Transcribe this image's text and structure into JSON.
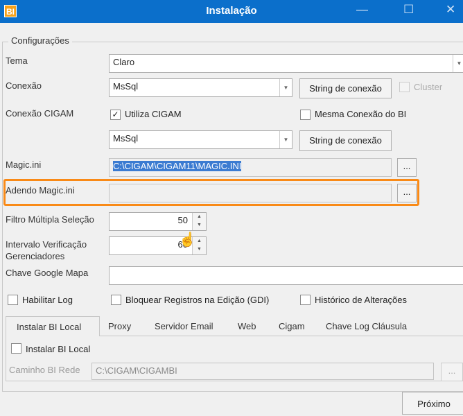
{
  "window": {
    "title": "Instalação",
    "logo": "BI",
    "controls": [
      "minimize-icon",
      "maximize-icon",
      "close-icon"
    ]
  },
  "group": {
    "label": "Configurações"
  },
  "tema": {
    "label": "Tema",
    "value": "Claro"
  },
  "conexao": {
    "label": "Conexão",
    "value": "MsSql",
    "button": "String de conexão",
    "cluster_label": "Cluster",
    "cluster_checked": false
  },
  "conexao_cigam": {
    "label": "Conexão CIGAM",
    "utiliza_label": "Utiliza CIGAM",
    "utiliza_checked": true,
    "mesma_label": "Mesma Conexão do BI",
    "mesma_checked": false,
    "value": "MsSql",
    "button": "String de conexão"
  },
  "magic": {
    "label": "Magic.ini",
    "value": "C:\\CIGAM\\CIGAM11\\MAGIC.INI",
    "browse": "..."
  },
  "adendo": {
    "label": "Adendo Magic.ini",
    "value": "",
    "browse": "..."
  },
  "filtro": {
    "label": "Filtro Múltipla Seleção",
    "value": "50"
  },
  "intervalo": {
    "label_line1": "Intervalo Verificação",
    "label_line2": "Gerenciadores",
    "value": "60"
  },
  "google": {
    "label": "Chave Google Mapa",
    "value": ""
  },
  "options": [
    {
      "label": "Habilitar Log",
      "checked": false
    },
    {
      "label": "Bloquear Registros na Edição (GDI)",
      "checked": false
    },
    {
      "label": "Histórico de Alterações",
      "checked": false
    }
  ],
  "tabs": [
    {
      "label": "Instalar BI Local",
      "active": true
    },
    {
      "label": "Proxy"
    },
    {
      "label": "Servidor Email"
    },
    {
      "label": "Web"
    },
    {
      "label": "Cigam"
    },
    {
      "label": "Chave Log Cláusula"
    }
  ],
  "tab_content": {
    "checkbox_label": "Instalar BI Local",
    "checked": false,
    "caminho_label": "Caminho BI Rede",
    "caminho_value": "C:\\CIGAM\\CIGAMBI",
    "browse": "..."
  },
  "footer": {
    "next": "Próximo"
  },
  "colors": {
    "titlebar": "#0b6fcb",
    "highlight": "#f98a17",
    "selection": "#3b7bd1"
  }
}
